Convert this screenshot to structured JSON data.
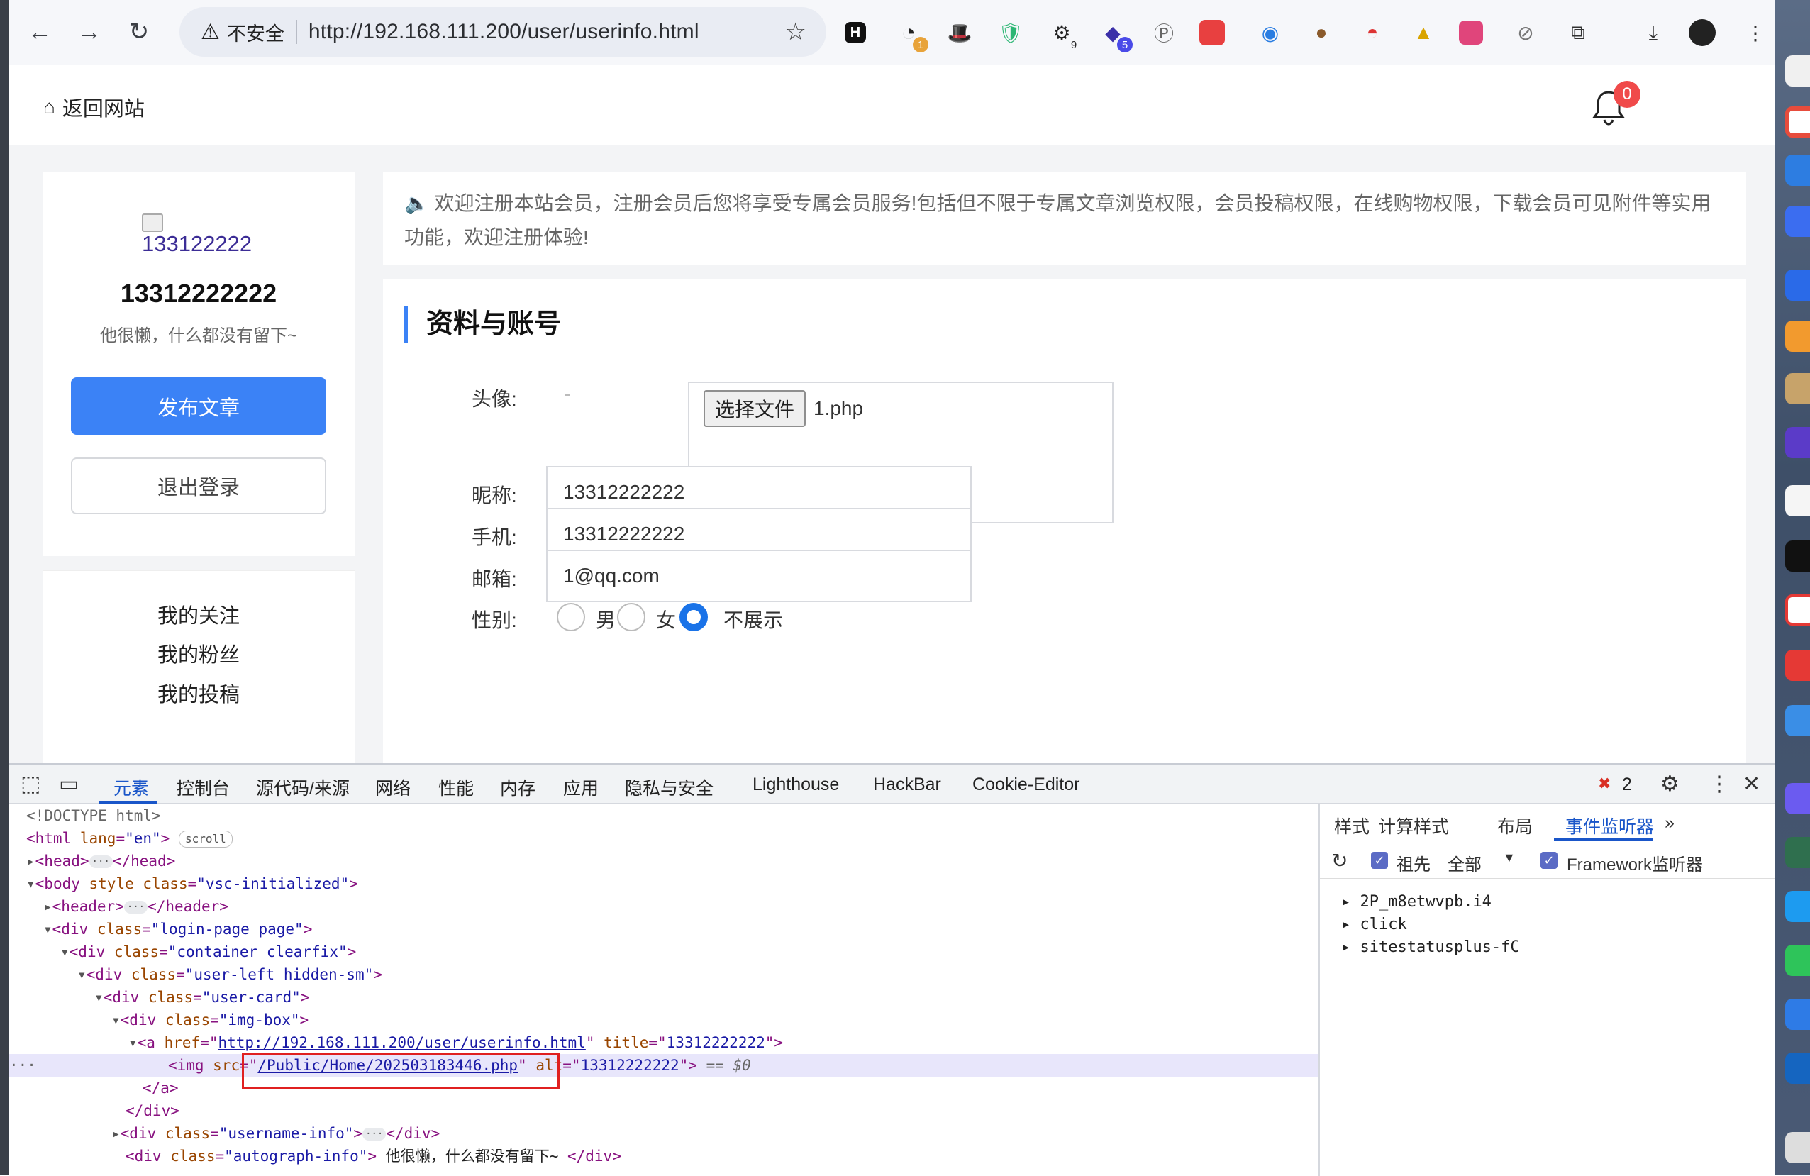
{
  "browser": {
    "insecure_label": "不安全",
    "url": "http://192.168.111.200/user/userinfo.html",
    "extension_badges": {
      "ext1": "1",
      "ext5": "9",
      "ext6": "5"
    }
  },
  "site_header": {
    "back_label": "返回网站",
    "notification_count": "0"
  },
  "user_card": {
    "avatar_alt": "133122222",
    "username": "13312222222",
    "signature": "他很懒，什么都没有留下~",
    "publish_label": "发布文章",
    "logout_label": "退出登录"
  },
  "user_menu": {
    "items": [
      "我的关注",
      "我的粉丝",
      "我的投稿"
    ]
  },
  "notice": {
    "text": "欢迎注册本站会员，注册会员后您将享受专属会员服务!包括但不限于专属文章浏览权限，会员投稿权限，在线购物权限，下载会员可见附件等实用功能，欢迎注册体验!"
  },
  "profile": {
    "title": "资料与账号",
    "avatar_label": "头像:",
    "file_button": "选择文件",
    "file_name": "1.php",
    "nickname_label": "昵称:",
    "nickname_value": "13312222222",
    "phone_label": "手机:",
    "phone_value": "13312222222",
    "email_label": "邮箱:",
    "email_value": "1@qq.com",
    "gender_label": "性别:",
    "gender_options": [
      "男",
      "女",
      "不展示"
    ]
  },
  "devtools": {
    "tabs": [
      "元素",
      "控制台",
      "源代码/来源",
      "网络",
      "性能",
      "内存",
      "应用",
      "隐私与安全",
      "Lighthouse",
      "HackBar",
      "Cookie-Editor"
    ],
    "error_count": "2",
    "dom": {
      "doctype": "<!DOCTYPE html>",
      "scroll_pill": "scroll",
      "img_src": "/Public/Home/202503183446.php",
      "img_alt": "13312222222",
      "a_href": "http://192.168.111.200/user/userinfo.html",
      "a_title": "13312222222",
      "autograph_text": " 他很懒，什么都没有留下~ ",
      "selected_suffix": " == $0"
    },
    "side_tabs": [
      "样式",
      "计算样式",
      "布局",
      "事件监听器"
    ],
    "ancestors_label": "祖先",
    "scope_label": "全部",
    "framework_label": "Framework监听器",
    "listeners": [
      "2P_m8etwvpb.i4",
      "click",
      "sitestatusplus-fC"
    ]
  },
  "colors": {
    "accent": "#3b82f6",
    "devtools_accent": "#1a56c9",
    "badge": "#f04a4a",
    "highlight_box": "#e02020"
  }
}
